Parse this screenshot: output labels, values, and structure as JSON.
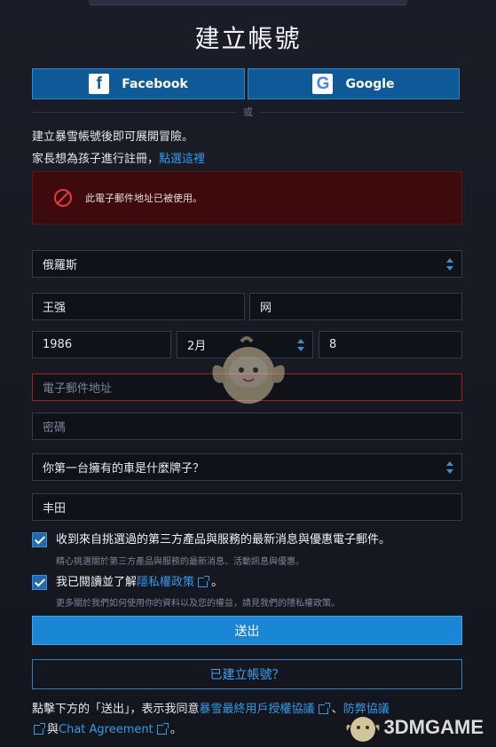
{
  "title": "建立帳號",
  "social": {
    "facebook_label": "Facebook",
    "google_label": "Google",
    "or": "或"
  },
  "intro": {
    "line1": "建立暴雪帳號後即可展開冒險。",
    "line2_prefix": "家長想為孩子進行註冊，",
    "line2_link": "點選這裡"
  },
  "error": {
    "message": "此電子郵件地址已被使用。"
  },
  "form": {
    "country": "俄羅斯",
    "first_name": "王强",
    "last_name": "网",
    "birth_year": "1986",
    "birth_month": "2月",
    "birth_day": "8",
    "email_placeholder": "電子郵件地址",
    "password_placeholder": "密碼",
    "security_question": "你第一台擁有的車是什麼牌子？",
    "security_answer": "丰田"
  },
  "checks": {
    "news_label": "收到來自挑選過的第三方產品與服務的最新消息與優惠電子郵件。",
    "news_sub": "精心挑選關於第三方產品與服務的最新消息、活動訊息與優惠。",
    "privacy_prefix": "我已閱讀並了解",
    "privacy_link": "隱私權政策",
    "privacy_suffix": "。",
    "privacy_sub": "更多關於我們如何使用你的資料以及您的權益，請見我們的隱私權政策。"
  },
  "buttons": {
    "submit": "送出",
    "have_account": "已建立帳號？"
  },
  "terms": {
    "prefix": "點擊下方的「送出」，表示我同意",
    "eula_link": "暴雪最終用戶授權協議",
    "sep1": "、",
    "anticheat_link": "防弊協議",
    "and": "與",
    "chat_link": "Chat Agreement",
    "suffix": "。"
  },
  "watermark": {
    "brand": "3DMGAME"
  },
  "colors": {
    "accent": "#1a86d6",
    "social_bg": "#0e5a99",
    "error_bg": "#3d0b0b",
    "error_border": "#a71d1d",
    "link": "#2f9ce8"
  }
}
